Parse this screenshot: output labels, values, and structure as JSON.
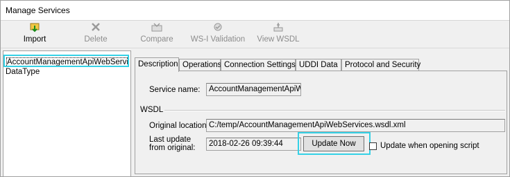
{
  "window": {
    "title": "Manage Services"
  },
  "toolbar": {
    "import": "Import",
    "delete": "Delete",
    "compare": "Compare",
    "wsi_validation": "WS-I Validation",
    "view_wsdl": "View WSDL"
  },
  "tree": {
    "items": [
      "AccountManagementApiWebServic",
      "DataType"
    ]
  },
  "tabs": [
    "Description",
    "Operations",
    "Connection Settings",
    "UDDI Data",
    "Protocol and Security"
  ],
  "description": {
    "service_name_label": "Service name:",
    "service_name_value": "AccountManagementApiWe",
    "wsdl_group": "WSDL",
    "original_location_label": "Original location:",
    "original_location_value": "C:/temp/AccountManagementApiWebServices.wsdl.xml",
    "last_update_label_1": "Last update",
    "last_update_label_2": "from original:",
    "last_update_value": "2018-02-26 09:39:44",
    "update_now": "Update Now",
    "update_when_opening": "Update when opening script"
  },
  "colors": {
    "highlight": "#35d1e6"
  }
}
